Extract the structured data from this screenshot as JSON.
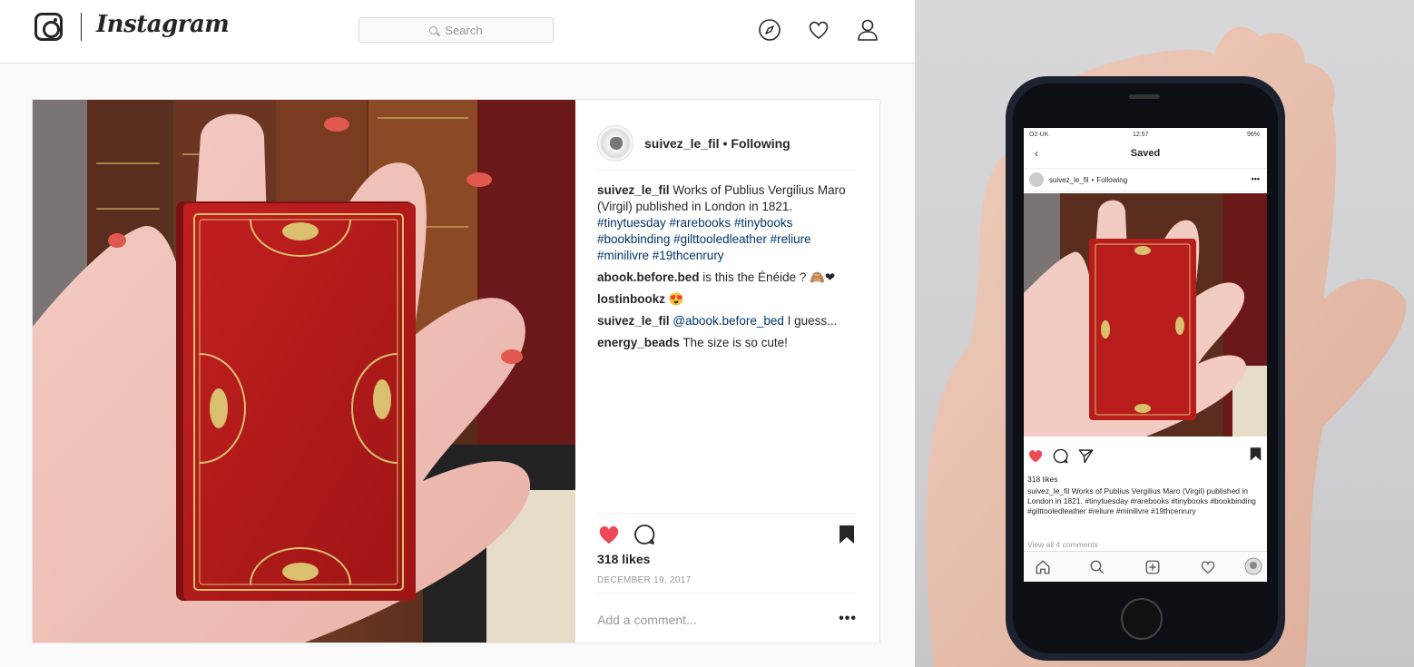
{
  "header": {
    "brand": "Instagram",
    "search_placeholder": "Search",
    "icons": [
      "instagram-logo-icon",
      "search-icon",
      "compass-icon",
      "heart-icon",
      "profile-icon"
    ]
  },
  "post": {
    "username": "suivez_le_fil",
    "separator": "•",
    "follow_status": "Following",
    "caption": {
      "user": "suivez_le_fil",
      "text": "Works of Publius Vergilius Maro (Virgil) published in London in 1821.",
      "hashtags": "#tinytuesday #rarebooks #tinybooks #bookbinding #gilttooledleather #reliure #minilivre #19thcenrury"
    },
    "comments": [
      {
        "user": "abook.before.bed",
        "text": "is this the Énéide ? 🙈❤"
      },
      {
        "user": "lostinbookz",
        "text": "😍"
      },
      {
        "user": "suivez_le_fil",
        "mention": "@abook.before_bed",
        "text": "I guess..."
      },
      {
        "user": "energy_beads",
        "text": "The size is so cute!"
      }
    ],
    "likes": "318 likes",
    "date": "DECEMBER 19, 2017",
    "add_comment_placeholder": "Add a comment...",
    "more_label": "•••",
    "liked": true,
    "saved": true
  },
  "phone": {
    "carrier": "O2-UK",
    "time": "12:57",
    "battery": "96%",
    "screen_title": "Saved",
    "back_label": "‹",
    "username": "suivez_le_fil",
    "separator": "•",
    "follow_status": "Following",
    "more_label": "•••",
    "likes": "318 likes",
    "caption_user": "suivez_le_fil",
    "caption_text": "Works of Publius Vergilius Maro (Virgil) published in London in 1821.",
    "caption_tags": "#tinytuesday #rarebooks #tinybooks #bookbinding #gilttooledleather #reliure #minilivre #19thcenrury",
    "view_all": "View all 4 comments"
  },
  "colors": {
    "like_red": "#ed4956",
    "link_blue": "#003569",
    "border": "#dbdbdb",
    "book_red": "#b3191b",
    "gilt": "#d9bf6e"
  }
}
